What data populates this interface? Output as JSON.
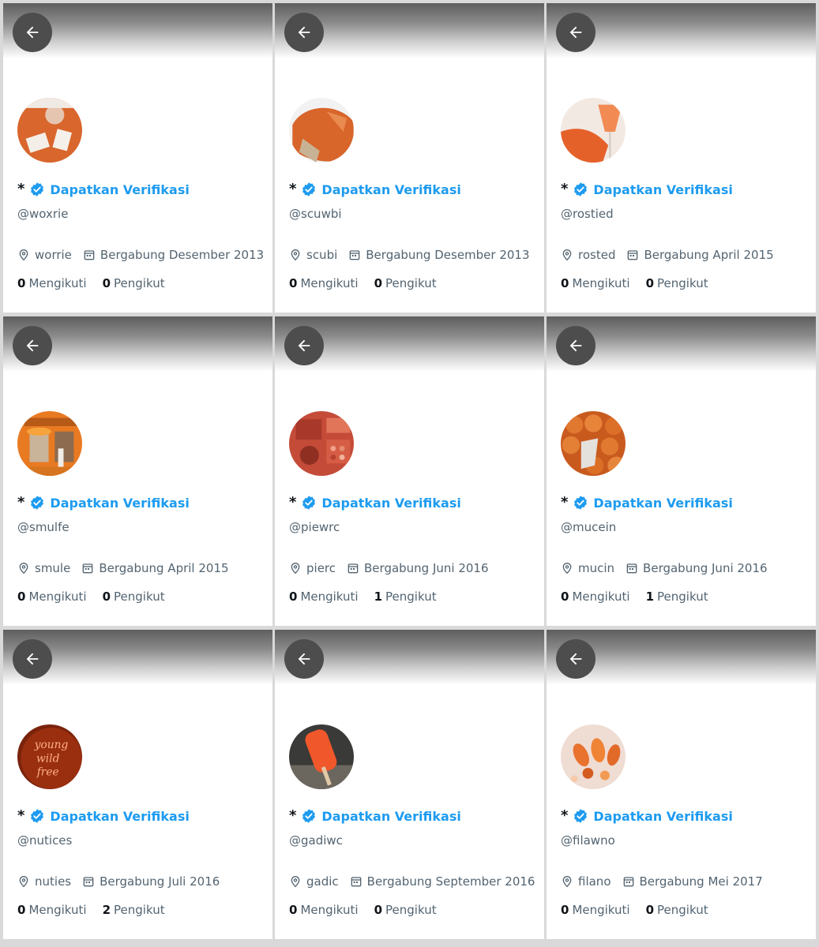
{
  "verify_label": "Dapatkan Verifikasi",
  "star": "*",
  "following_label": "Mengikuti",
  "followers_label": "Pengikut",
  "accent_color": "#1d9bf0",
  "profiles": [
    {
      "handle": "@woxrie",
      "location": "worrie",
      "joined": "Bergabung Desember 2013",
      "following": "0",
      "followers": "0",
      "avatar": "orange-table-photo"
    },
    {
      "handle": "@scuwbi",
      "location": "scubi",
      "joined": "Bergabung Desember 2013",
      "following": "0",
      "followers": "0",
      "avatar": "orange-paint-photo"
    },
    {
      "handle": "@rostied",
      "location": "rosted",
      "joined": "Bergabung April 2015",
      "following": "0",
      "followers": "0",
      "avatar": "orange-drink-photo"
    },
    {
      "handle": "@smulfe",
      "location": "smule",
      "joined": "Bergabung April 2015",
      "following": "0",
      "followers": "0",
      "avatar": "orange-storefront-photo"
    },
    {
      "handle": "@piewrc",
      "location": "pierc",
      "joined": "Bergabung Juni 2016",
      "following": "0",
      "followers": "1",
      "avatar": "orange-makeup-photo"
    },
    {
      "handle": "@mucein",
      "location": "mucin",
      "joined": "Bergabung Juni 2016",
      "following": "0",
      "followers": "1",
      "avatar": "orange-fruits-photo"
    },
    {
      "handle": "@nutices",
      "location": "nuties",
      "joined": "Bergabung Juli 2016",
      "following": "0",
      "followers": "2",
      "avatar": "neon-sign-photo"
    },
    {
      "handle": "@gadiwc",
      "location": "gadic",
      "joined": "Bergabung September 2016",
      "following": "0",
      "followers": "0",
      "avatar": "orange-popsicle-photo"
    },
    {
      "handle": "@filawno",
      "location": "filano",
      "joined": "Bergabung Mei 2017",
      "following": "0",
      "followers": "0",
      "avatar": "orange-nails-photo"
    }
  ]
}
